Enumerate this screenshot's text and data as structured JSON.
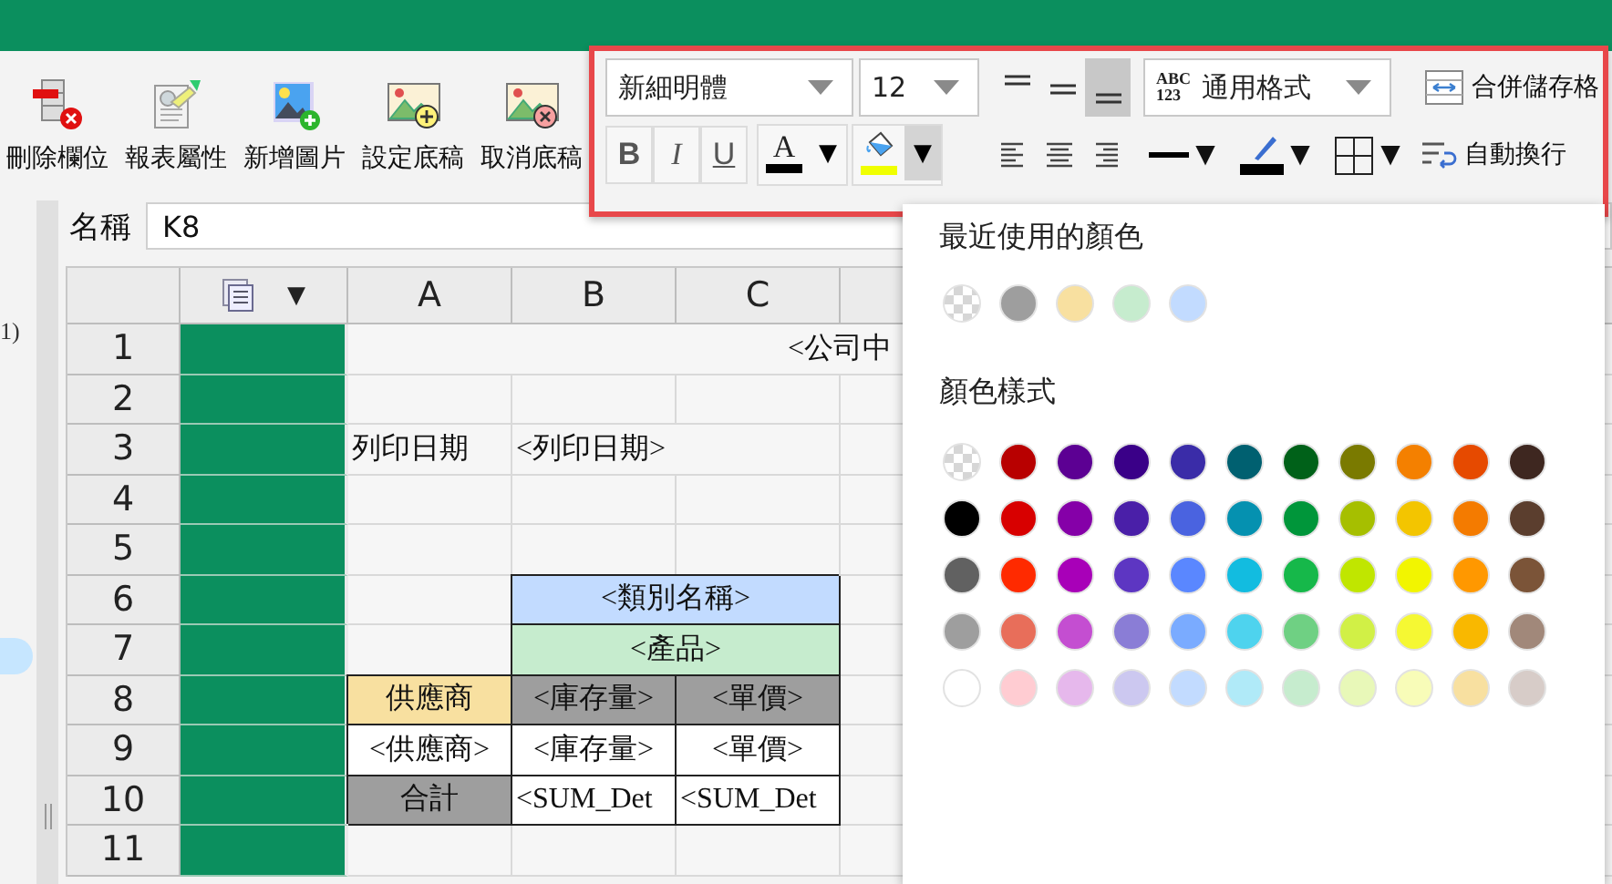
{
  "toolbar": {
    "buttons": [
      {
        "kind": "delete-column",
        "label": "刪除欄位"
      },
      {
        "kind": "report-properties",
        "label": "報表屬性"
      },
      {
        "kind": "add-image",
        "label": "新增圖片"
      },
      {
        "kind": "set-background",
        "label": "設定底稿"
      },
      {
        "kind": "remove-background",
        "label": "取消底稿"
      }
    ]
  },
  "format_toolbar": {
    "font": {
      "value": "新細明體"
    },
    "size": {
      "value": "12"
    },
    "vertical_align": [
      {
        "kind": "top",
        "selected": false
      },
      {
        "kind": "middle",
        "selected": false
      },
      {
        "kind": "bottom",
        "selected": true
      }
    ],
    "number_format": {
      "icon_text": [
        "ABC",
        "123"
      ],
      "value": "通用格式"
    },
    "merge_button": {
      "label": "合併儲存格"
    },
    "text_style": [
      {
        "kind": "bold",
        "label": "B",
        "selected": false
      },
      {
        "kind": "italic",
        "label": "I",
        "selected": false
      },
      {
        "kind": "underline",
        "label": "U",
        "selected": false
      }
    ],
    "font_color": {
      "letter": "A",
      "color": "#000000",
      "arrow": "▼",
      "expanded": false
    },
    "fill_color": {
      "color": "#f0ff00",
      "arrow": "▼",
      "expanded": true
    },
    "horizontal_align": [
      {
        "kind": "left",
        "selected": false
      },
      {
        "kind": "center",
        "selected": false
      },
      {
        "kind": "right",
        "selected": false
      }
    ],
    "border_style": {
      "arrow": "▼"
    },
    "border_color": {
      "color": "#000000",
      "arrow": "▼"
    },
    "borders": {
      "arrow": "▼"
    },
    "wrap_button": {
      "label": "自動換行"
    }
  },
  "sidebar": {
    "text": "1)"
  },
  "name_box": {
    "label": "名稱",
    "value": "K8"
  },
  "sheet": {
    "menu_arrow": "▼",
    "columns": [
      "A",
      "B",
      "C"
    ],
    "rows": [
      {
        "number": "1",
        "cells": [
          {
            "kind": "title",
            "text": "<公司中",
            "centered": true
          }
        ]
      },
      {
        "number": "2",
        "cells": []
      },
      {
        "number": "3",
        "cells": [
          {
            "kind": "single",
            "text": "列印日期",
            "centered": false
          },
          {
            "kind": "merged",
            "text": "<列印日期>",
            "centered": false
          }
        ]
      },
      {
        "number": "4",
        "cells": []
      },
      {
        "number": "5",
        "cells": []
      },
      {
        "number": "6",
        "cells": [
          {
            "kind": "single"
          },
          {
            "kind": "merged",
            "text": "<類別名稱>",
            "centered": true,
            "bordered": true,
            "color": "#c2dbff"
          }
        ]
      },
      {
        "number": "7",
        "cells": [
          {
            "kind": "single"
          },
          {
            "kind": "merged",
            "text": "<產品>",
            "centered": true,
            "bordered": true,
            "color": "#c6ecce"
          }
        ]
      },
      {
        "number": "8",
        "cells": [
          {
            "kind": "single",
            "text": "供應商",
            "centered": true,
            "bordered": true,
            "color": "#f8e0a0"
          },
          {
            "kind": "single",
            "text": "<庫存量>",
            "centered": true,
            "bordered": true,
            "color": "#9e9e9e"
          },
          {
            "kind": "single",
            "text": "<單價>",
            "centered": true,
            "bordered": true,
            "color": "#9e9e9e"
          }
        ]
      },
      {
        "number": "9",
        "cells": [
          {
            "kind": "single",
            "text": "<供應商>",
            "centered": true,
            "bordered": true,
            "color": "#ffffff"
          },
          {
            "kind": "single",
            "text": "<庫存量>",
            "centered": true,
            "bordered": true,
            "color": "#ffffff"
          },
          {
            "kind": "single",
            "text": "<單價>",
            "centered": true,
            "bordered": true,
            "color": "#ffffff"
          }
        ]
      },
      {
        "number": "10",
        "cells": [
          {
            "kind": "single",
            "text": "合計",
            "centered": true,
            "bordered": true,
            "color": "#9e9e9e"
          },
          {
            "kind": "single",
            "text": "<SUM_Det",
            "centered": false,
            "bordered": true,
            "color": "#ffffff"
          },
          {
            "kind": "single",
            "text": "<SUM_Det",
            "centered": false,
            "bordered": true,
            "color": "#ffffff"
          }
        ]
      },
      {
        "number": "11",
        "cells": []
      }
    ]
  },
  "color_menu": {
    "recent_title": "最近使用的顏色",
    "recent": [
      {
        "kind": "none"
      },
      {
        "kind": "swatch",
        "color": "#9e9e9e"
      },
      {
        "kind": "swatch",
        "color": "#f8e0a0"
      },
      {
        "kind": "swatch",
        "color": "#c6ecce"
      },
      {
        "kind": "swatch",
        "color": "#c2dbff"
      }
    ],
    "palette_title": "顏色樣式",
    "palette": [
      {
        "swatches": [
          {
            "kind": "none"
          },
          {
            "kind": "swatch",
            "color": "#b80000"
          },
          {
            "kind": "swatch",
            "color": "#5c0093"
          },
          {
            "kind": "swatch",
            "color": "#3a0088"
          },
          {
            "kind": "swatch",
            "color": "#3a2ca8"
          },
          {
            "kind": "swatch",
            "color": "#006070"
          },
          {
            "kind": "swatch",
            "color": "#006119"
          },
          {
            "kind": "swatch",
            "color": "#7a7a00"
          },
          {
            "kind": "swatch",
            "color": "#f48000"
          },
          {
            "kind": "swatch",
            "color": "#e64a00"
          },
          {
            "kind": "swatch",
            "color": "#3e2720"
          }
        ]
      },
      {
        "swatches": [
          {
            "kind": "swatch",
            "color": "#000000"
          },
          {
            "kind": "swatch",
            "color": "#d80000"
          },
          {
            "kind": "swatch",
            "color": "#8500a8"
          },
          {
            "kind": "swatch",
            "color": "#4a1fa8"
          },
          {
            "kind": "swatch",
            "color": "#4a63e0"
          },
          {
            "kind": "swatch",
            "color": "#0591b0"
          },
          {
            "kind": "swatch",
            "color": "#00963a"
          },
          {
            "kind": "swatch",
            "color": "#a6bf00"
          },
          {
            "kind": "swatch",
            "color": "#f3c500"
          },
          {
            "kind": "swatch",
            "color": "#f47b00"
          },
          {
            "kind": "swatch",
            "color": "#5b3e2e"
          }
        ]
      },
      {
        "swatches": [
          {
            "kind": "swatch",
            "color": "#616161"
          },
          {
            "kind": "swatch",
            "color": "#ff2a00"
          },
          {
            "kind": "swatch",
            "color": "#a800b8"
          },
          {
            "kind": "swatch",
            "color": "#5d36c2"
          },
          {
            "kind": "swatch",
            "color": "#5a87ff"
          },
          {
            "kind": "swatch",
            "color": "#12bce0"
          },
          {
            "kind": "swatch",
            "color": "#16b84a"
          },
          {
            "kind": "swatch",
            "color": "#c0e600"
          },
          {
            "kind": "swatch",
            "color": "#f2f500"
          },
          {
            "kind": "swatch",
            "color": "#ff9800"
          },
          {
            "kind": "swatch",
            "color": "#7b5438"
          }
        ]
      },
      {
        "swatches": [
          {
            "kind": "swatch",
            "color": "#9e9e9e"
          },
          {
            "kind": "swatch",
            "color": "#e86e5a"
          },
          {
            "kind": "swatch",
            "color": "#c44ed1"
          },
          {
            "kind": "swatch",
            "color": "#8a7dd6"
          },
          {
            "kind": "swatch",
            "color": "#7aabff"
          },
          {
            "kind": "swatch",
            "color": "#4ed3ee"
          },
          {
            "kind": "swatch",
            "color": "#6fd083"
          },
          {
            "kind": "swatch",
            "color": "#d1f046"
          },
          {
            "kind": "swatch",
            "color": "#f5f833"
          },
          {
            "kind": "swatch",
            "color": "#f9b800"
          },
          {
            "kind": "swatch",
            "color": "#a1887a"
          }
        ]
      },
      {
        "swatches": [
          {
            "kind": "swatch",
            "color": "#ffffff"
          },
          {
            "kind": "swatch",
            "color": "#ffccd2"
          },
          {
            "kind": "swatch",
            "color": "#e6b8ec"
          },
          {
            "kind": "swatch",
            "color": "#ccc8f0"
          },
          {
            "kind": "swatch",
            "color": "#c2dbff"
          },
          {
            "kind": "swatch",
            "color": "#b0eaf8"
          },
          {
            "kind": "swatch",
            "color": "#c6ecce"
          },
          {
            "kind": "swatch",
            "color": "#e8f8b8"
          },
          {
            "kind": "swatch",
            "color": "#f8fcb8"
          },
          {
            "kind": "swatch",
            "color": "#f8e0a0"
          },
          {
            "kind": "swatch",
            "color": "#d7ccc8"
          }
        ]
      }
    ]
  }
}
